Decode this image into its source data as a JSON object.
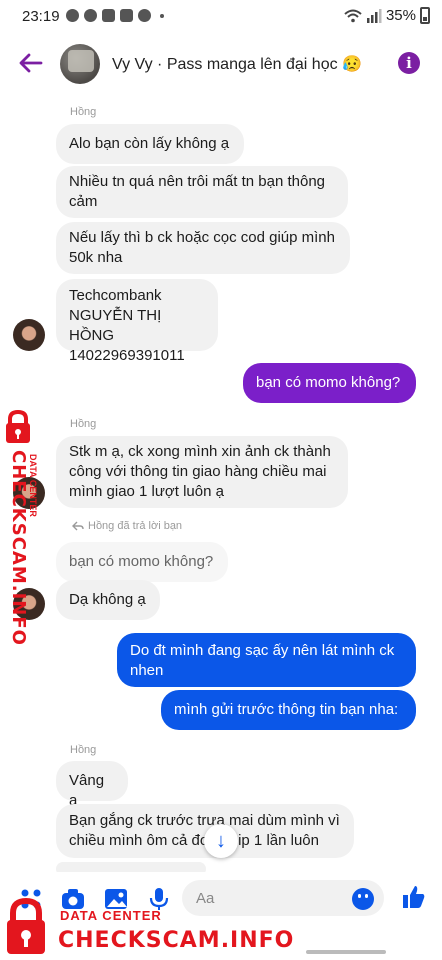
{
  "status_bar": {
    "time": "23:19",
    "battery": "35%"
  },
  "header": {
    "title": "Vy Vy · Pass manga lên đại học 😥"
  },
  "messages": {
    "sender1": "Hồng",
    "m1": "Alo bạn còn lấy không ạ",
    "m2a": "Nhiều tn quá nên trôi mất tn bạn thông",
    "m2b": "cảm",
    "m3a": "Nếu lấy thì b ck hoặc cọc cod giúp mình",
    "m3b": "50k nha",
    "m4a": "Techcombank",
    "m4b": "NGUYỄN THỊ HỒNG",
    "m4c": "14022969391011",
    "o1": "bạn có momo không?",
    "sender2": "Hồng",
    "m5a": "Stk m ạ, ck xong mình xin ảnh ck thành",
    "m5b": "công với thông tin giao hàng chiều mai",
    "m5c": "mình giao 1 lượt luôn ạ",
    "reply_note": "Hồng đã trả lời bạn",
    "quoted": "bạn có momo không?",
    "m6": "Dạ không ạ",
    "o2a": "Do đt mình đang sạc ấy nên lát mình ck",
    "o2b": "nhen",
    "o3": "mình gửi trước thông tin bạn nha:",
    "sender3": "Hồng",
    "m7": "Vâng ạ",
    "m8a": "Bạn gắng ck trước trưa mai dùm mình vì",
    "m8b": "chiều mình ôm cả đơn ship 1 lần luôn"
  },
  "composer": {
    "placeholder": "Aa"
  },
  "watermark": {
    "side_big": "CHECKSCAM.INFO",
    "side_small": "DATA CENTER",
    "bottom_small": "DATA CENTER",
    "bottom_big": "CHECKSCAM.INFO"
  },
  "colors": {
    "accent_purple": "#7b1fa2",
    "outgoing_purple": "#7b1fc9",
    "outgoing_blue": "#0b57e8",
    "incoming_bg": "#f1f1f1",
    "watermark_red": "#e3161e"
  },
  "icons": [
    "back-arrow-icon",
    "info-icon",
    "grid-dots-icon",
    "camera-icon",
    "image-icon",
    "microphone-icon",
    "emoji-icon",
    "like-icon",
    "scroll-down-icon",
    "lock-icon"
  ]
}
